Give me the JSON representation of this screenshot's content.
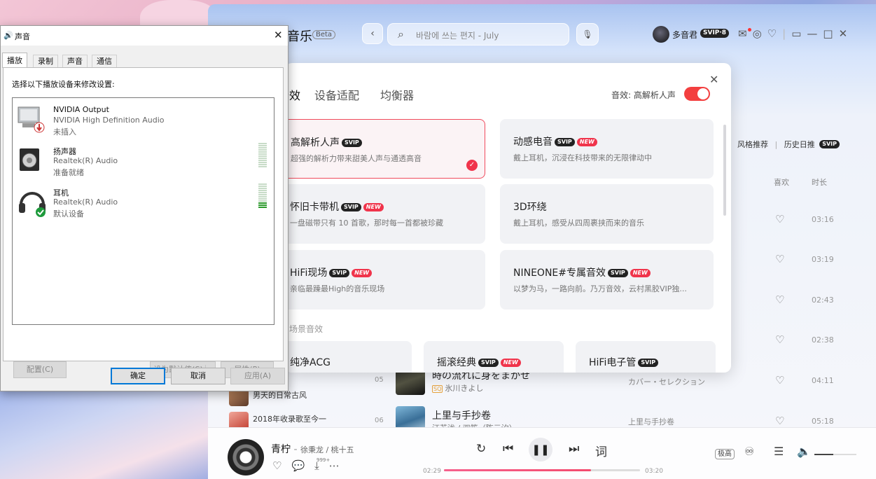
{
  "music_app": {
    "logo_text": "音乐",
    "beta": "Beta",
    "search_placeholder": "바람에 쓰는 편지 - July",
    "username": "多音君",
    "user_badge": "SVIP·8",
    "right_nav": {
      "style": "风格推荐",
      "sep": "|",
      "history": "历史日推",
      "history_badge": "SVIP"
    },
    "columns": {
      "like": "喜欢",
      "duration": "时长"
    },
    "durations": [
      "03:16",
      "03:19",
      "02:43",
      "02:38",
      "04:11",
      "05:18"
    ],
    "rows": [
      {
        "num": "05",
        "title": "時の流れに身をまかせ",
        "artist": "氷川きよし",
        "quality": "SQ",
        "album": "カバー・セレクション"
      },
      {
        "num": "06",
        "title": "上里与手抄卷",
        "artist": "汪苏泷 / 双笙（陈元汐）",
        "quality": "",
        "album": "上里与手抄卷"
      }
    ],
    "sidebar": [
      "男天的日常古风",
      "2018年收录歌至今一"
    ]
  },
  "player": {
    "title": "青柠",
    "artist": "徐秉龙 / 桃十五",
    "comment_count": "999+",
    "time_current": "02:29",
    "time_total": "03:20",
    "progress": 0.75,
    "quality_btn": "极高",
    "lyrics": "词",
    "volume": 0.45
  },
  "modal": {
    "tabs": [
      "音效",
      "设备适配",
      "均衡器"
    ],
    "effect_label": "音效: 高解析人声",
    "cards": [
      {
        "title": "高解析人声",
        "desc": "超强的解析力带来甜美人声与通透高音",
        "svip": true,
        "new": false,
        "selected": true
      },
      {
        "title": "动感电音",
        "desc": "戴上耳机，沉浸在科技带来的无限律动中",
        "svip": true,
        "new": true,
        "selected": false
      },
      {
        "title": "怀旧卡带机",
        "desc": "一盘磁带只有 10 首歌，那时每一首都被珍藏",
        "svip": true,
        "new": true,
        "selected": false
      },
      {
        "title": "3D环绕",
        "desc": "戴上耳机，感受从四周裹挟而来的音乐",
        "svip": false,
        "new": false,
        "selected": false
      },
      {
        "title": "HiFi现场",
        "desc": "亲临最躁最High的音乐现场",
        "svip": true,
        "new": true,
        "selected": false
      },
      {
        "title": "NINEONE#专属音效",
        "desc": "以梦为马，一路向前。乃万音效，云村黑胶VIP独...",
        "svip": true,
        "new": true,
        "selected": false
      }
    ],
    "section_label": "场景音效",
    "bottom_cards": [
      {
        "title": "纯净ACG",
        "svip": false,
        "new": false
      },
      {
        "title": "摇滚经典",
        "svip": true,
        "new": true
      },
      {
        "title": "HiFi电子管",
        "svip": true,
        "new": false
      }
    ],
    "badge_svip": "SVIP",
    "badge_new": "NEW"
  },
  "sound_dialog": {
    "title": "声音",
    "tabs": [
      "播放",
      "录制",
      "声音",
      "通信"
    ],
    "instruction": "选择以下播放设备来修改设置:",
    "devices": [
      {
        "name": "NVIDIA Output",
        "driver": "NVIDIA High Definition Audio",
        "status": "未插入",
        "level": 0
      },
      {
        "name": "扬声器",
        "driver": "Realtek(R) Audio",
        "status": "准备就绪",
        "level": 0
      },
      {
        "name": "耳机",
        "driver": "Realtek(R) Audio",
        "status": "默认设备",
        "level": 3
      }
    ],
    "buttons": {
      "configure": "配置(C)",
      "set_default": "设为默认值(S)",
      "properties": "属性(P)",
      "ok": "确定",
      "cancel": "取消",
      "apply": "应用(A)"
    }
  }
}
